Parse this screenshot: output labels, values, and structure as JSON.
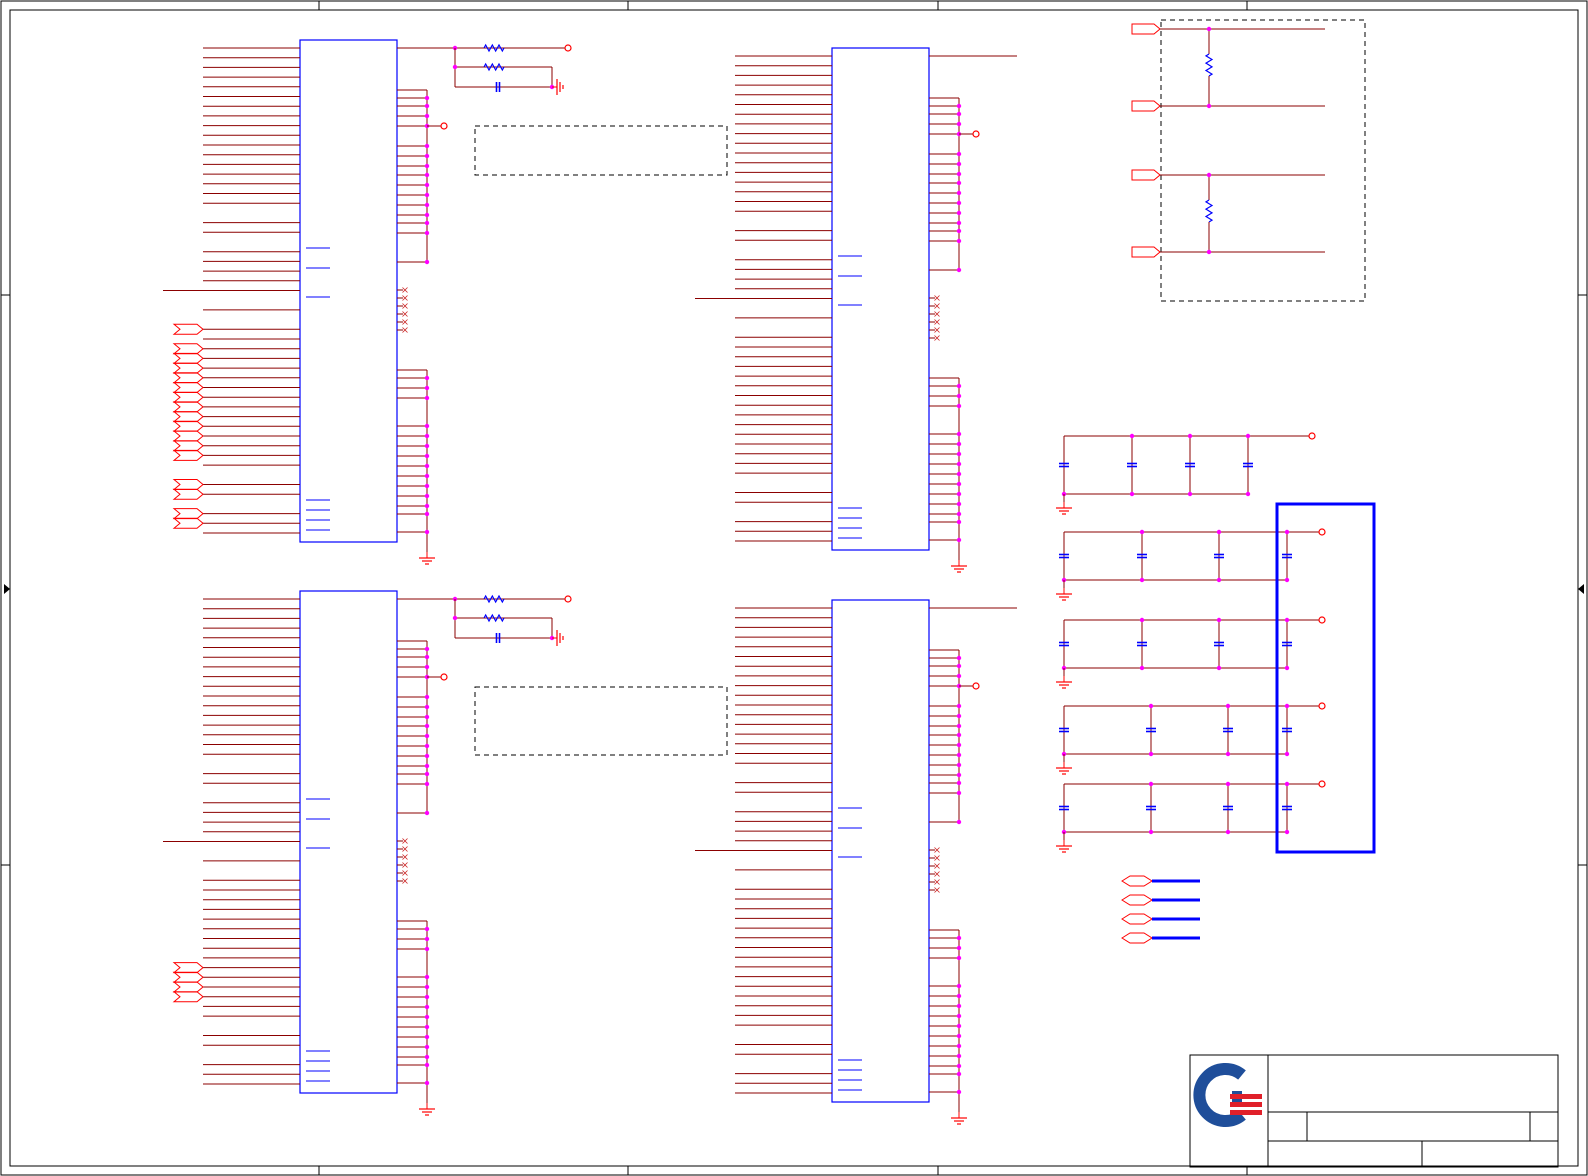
{
  "sheet": {
    "colors": {
      "border": "#000000",
      "wire": "#8b0000",
      "net": "#cc2222",
      "component": "#0000ff",
      "junction": "#ff00ff",
      "port": "#ff0000",
      "ground": "#ff0000",
      "annotation_box": "#000000",
      "highlight": "#0000ff",
      "logo_blue": "#1f4e9a",
      "logo_red": "#e0202a"
    },
    "title_block": {
      "logo": "company-logo"
    }
  }
}
